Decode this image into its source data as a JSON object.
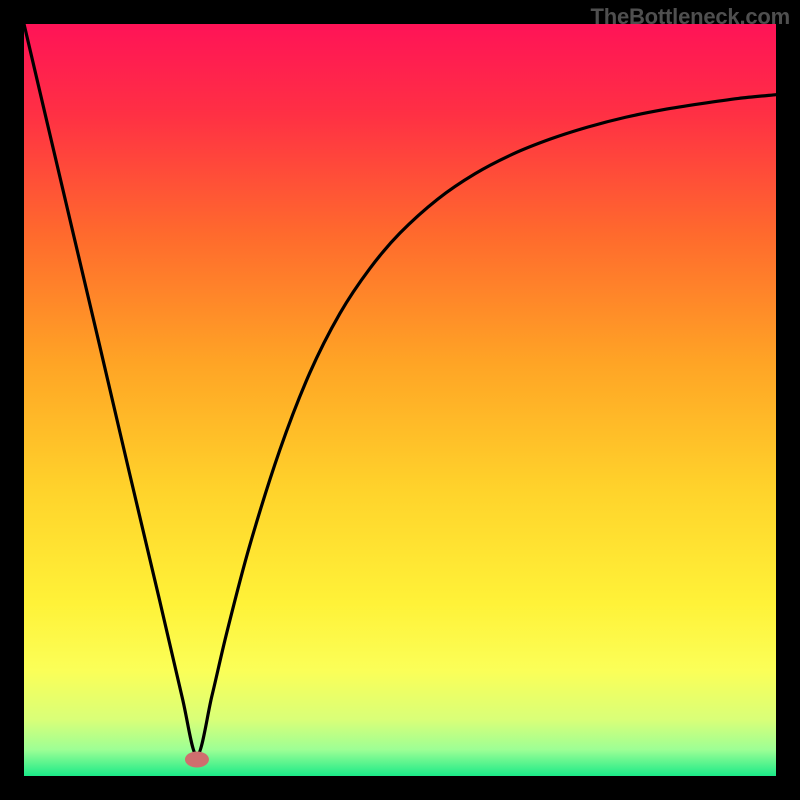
{
  "attribution": "TheBottleneck.com",
  "chart_data": {
    "type": "line",
    "title": "",
    "xlabel": "",
    "ylabel": "",
    "xlim": [
      0,
      100
    ],
    "ylim": [
      0,
      100
    ],
    "x_min_curve": 23,
    "series": [
      {
        "name": "curve",
        "x": [
          0,
          5,
          10,
          14,
          18,
          21,
          23,
          25,
          27,
          30,
          34,
          38,
          42,
          46,
          50,
          55,
          60,
          65,
          70,
          75,
          80,
          85,
          90,
          95,
          100
        ],
        "y": [
          100,
          78.7,
          57.5,
          40.4,
          23.5,
          10.6,
          2.8,
          10.7,
          19.2,
          30.6,
          43.3,
          53.6,
          61.5,
          67.5,
          72.2,
          76.7,
          80.1,
          82.7,
          84.7,
          86.3,
          87.6,
          88.6,
          89.4,
          90.1,
          90.6
        ]
      }
    ],
    "marker": {
      "x": 23,
      "y": 2.2,
      "color": "#cf6e6e"
    },
    "gradient_stops": [
      {
        "offset": 0.0,
        "color": "#ff1357"
      },
      {
        "offset": 0.12,
        "color": "#ff3044"
      },
      {
        "offset": 0.28,
        "color": "#ff6a2d"
      },
      {
        "offset": 0.45,
        "color": "#ffa425"
      },
      {
        "offset": 0.62,
        "color": "#ffd32b"
      },
      {
        "offset": 0.77,
        "color": "#fff238"
      },
      {
        "offset": 0.86,
        "color": "#fbff58"
      },
      {
        "offset": 0.925,
        "color": "#d9ff78"
      },
      {
        "offset": 0.965,
        "color": "#9dff95"
      },
      {
        "offset": 1.0,
        "color": "#1bea88"
      }
    ]
  }
}
